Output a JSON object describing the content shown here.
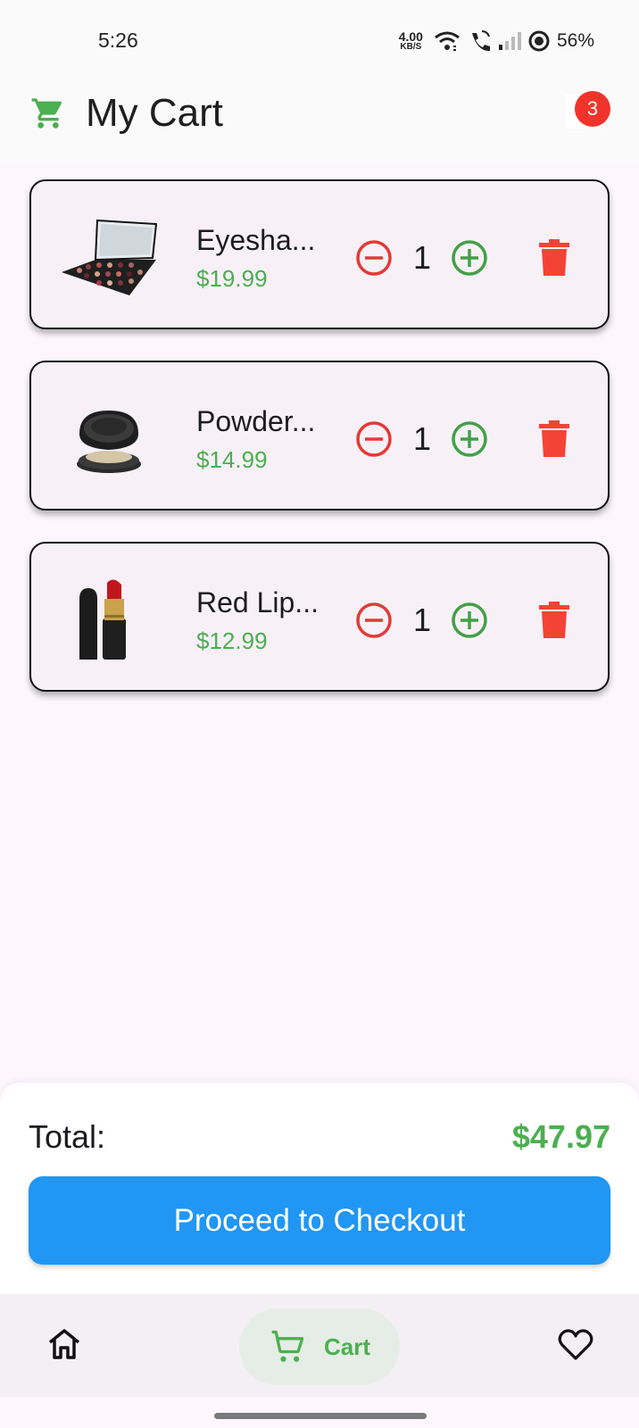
{
  "status_bar": {
    "time": "5:26",
    "net_speed_value": "4.00",
    "net_speed_unit": "KB/S",
    "battery": "56%"
  },
  "header": {
    "title": "My Cart",
    "badge_count": "3",
    "accent_color": "#4caf50"
  },
  "cart_items": [
    {
      "name": "Eyesha...",
      "price": "$19.99",
      "quantity": "1",
      "image_icon": "eyeshadow-palette"
    },
    {
      "name": "Powder...",
      "price": "$14.99",
      "quantity": "1",
      "image_icon": "powder-compact"
    },
    {
      "name": "Red Lip...",
      "price": "$12.99",
      "quantity": "1",
      "image_icon": "red-lipstick"
    }
  ],
  "summary": {
    "total_label": "Total:",
    "total_value": "$47.97",
    "checkout_label": "Proceed to Checkout",
    "checkout_color": "#2196f3"
  },
  "bottom_nav": {
    "cart_label": "Cart"
  },
  "colors": {
    "minus": "#e53935",
    "plus": "#43a047",
    "delete": "#f44336",
    "price": "#4caf50"
  }
}
